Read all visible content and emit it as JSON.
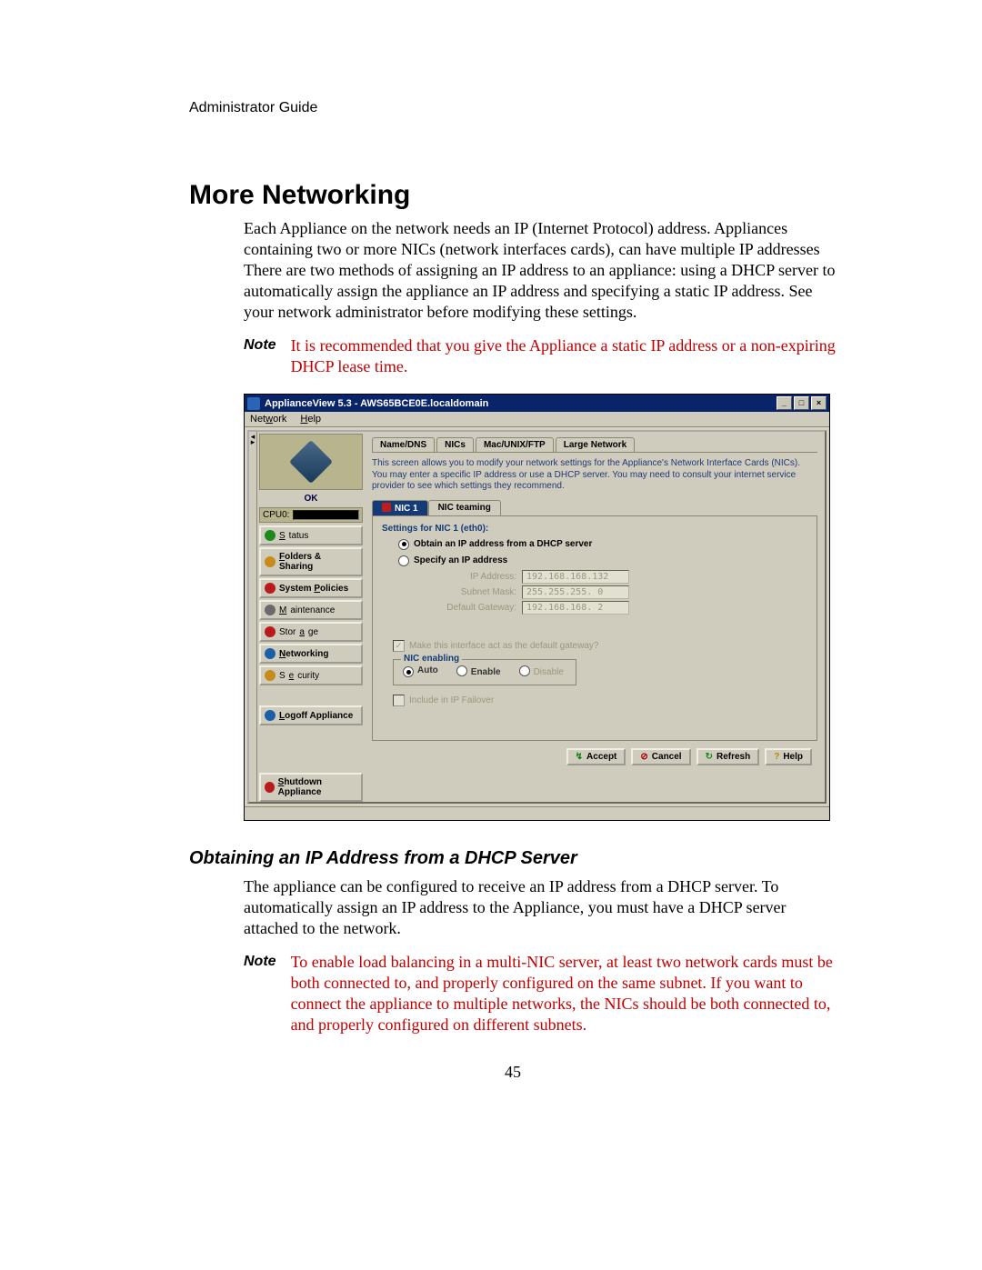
{
  "doc": {
    "header": "Administrator Guide",
    "h1": "More Networking",
    "intro": "Each Appliance on the network needs an IP (Internet Protocol) address. Appliances containing two or more NICs (network interfaces cards), can have multiple IP addresses There are two methods of assigning an IP address to an appliance: using a DHCP server to automatically assign the appliance an IP address and specifying a static IP address. See your network administrator before modifying these settings.",
    "note1_label": "Note",
    "note1_text": "It is recommended that you give the Appliance a static IP address or a non-expiring DHCP lease time.",
    "h2": "Obtaining an IP Address from a DHCP Server",
    "p2": "The appliance can be configured to receive an IP address from a DHCP server. To automatically assign an IP address to the Appliance, you must have a DHCP server attached to the network.",
    "note2_label": "Note",
    "note2_text": "To enable load balancing in a multi-NIC server, at least two network cards must be both connected to, and properly configured on the same subnet. If you want to connect the appliance to multiple networks, the NICs should be both connected to, and properly configured on different subnets.",
    "page_number": "45"
  },
  "shot": {
    "title": "ApplianceView 5.3 - AWS65BCE0E.localdomain",
    "menu": {
      "network": "Network",
      "help": "Help"
    },
    "left": {
      "ok": "OK",
      "cpu_label": "CPU0:",
      "nav": {
        "status": "Status",
        "folders": "Folders & Sharing",
        "policies": "System Policies",
        "maintenance": "Maintenance",
        "storage": "Storage",
        "networking": "Networking",
        "security": "Security",
        "logoff": "Logoff Appliance",
        "shutdown": "Shutdown Appliance"
      }
    },
    "tabs": {
      "namedns": "Name/DNS",
      "nics": "NICs",
      "macunix": "Mac/UNIX/FTP",
      "large": "Large Network"
    },
    "desc": "This screen allows you to modify your network settings for the Appliance's Network Interface Cards (NICs). You may enter a specific IP address or use a DHCP server. You may need to consult your internet service provider to see which settings they recommend.",
    "subtabs": {
      "nic1": "NIC 1",
      "teaming": "NIC teaming"
    },
    "panel": {
      "settings_title": "Settings for NIC 1 (eth0):",
      "radio_dhcp": "Obtain an IP address from a DHCP server",
      "radio_static": "Specify an IP address",
      "ip_label": "IP Address:",
      "ip_value": "192.168.168.132",
      "mask_label": "Subnet Mask:",
      "mask_value": "255.255.255. 0",
      "gw_label": "Default Gateway:",
      "gw_value": "192.168.168. 2",
      "default_gw_chk": "Make this interface act as the default gateway?",
      "nic_enabling": "NIC enabling",
      "auto": "Auto",
      "enable": "Enable",
      "disable": "Disable",
      "failover": "Include in IP Failover"
    },
    "buttons": {
      "accept": "Accept",
      "cancel": "Cancel",
      "refresh": "Refresh",
      "help": "Help"
    }
  }
}
